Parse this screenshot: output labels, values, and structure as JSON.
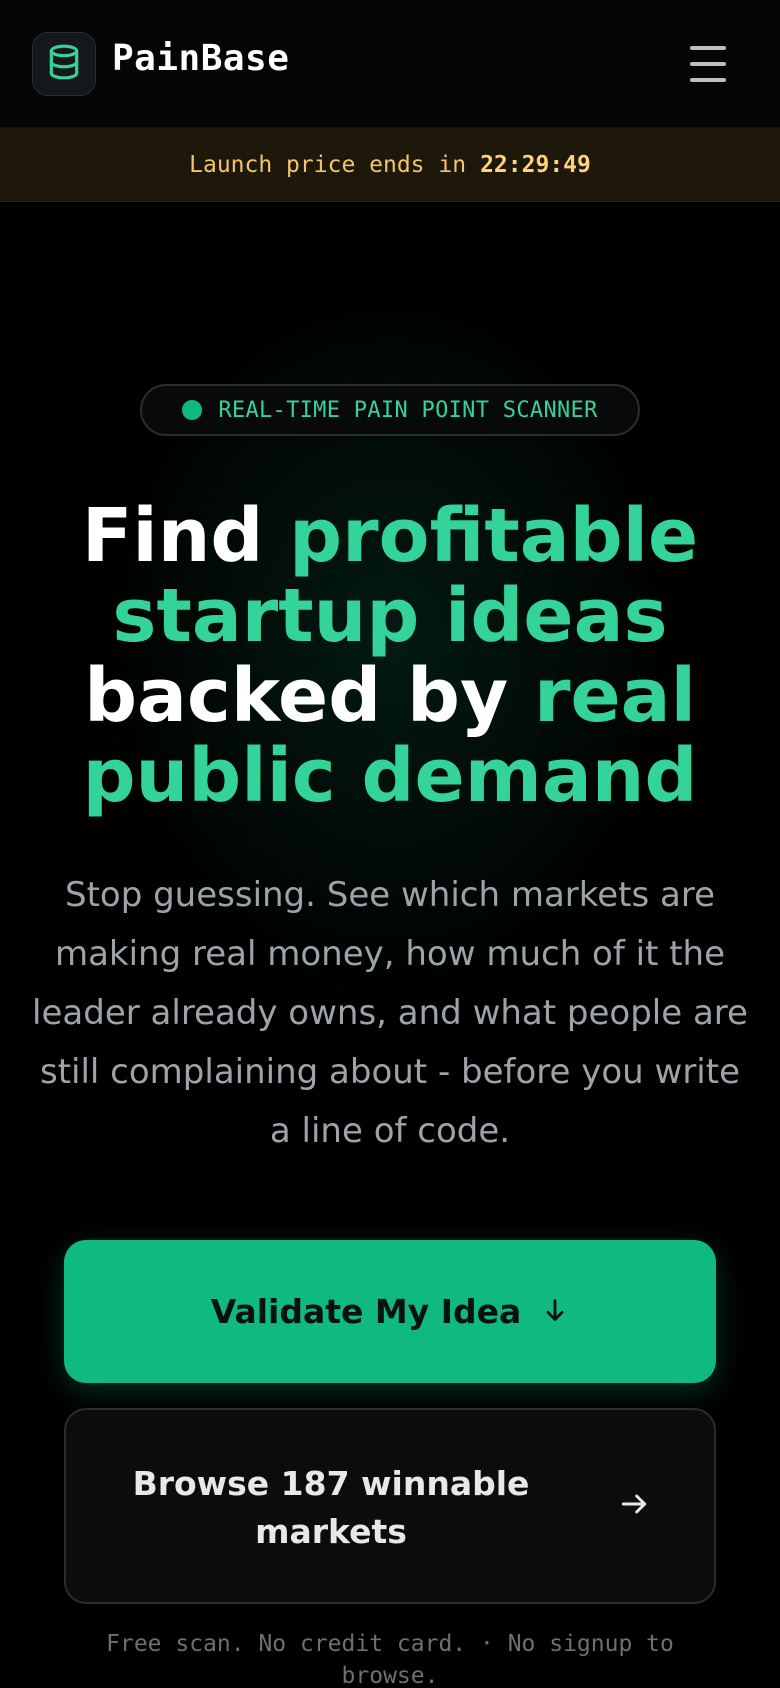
{
  "header": {
    "brand": "PainBase",
    "logo_icon": "database-icon",
    "menu_icon": "hamburger-menu-icon"
  },
  "banner": {
    "text": "Launch price ends in",
    "countdown": "22:29:49"
  },
  "hero": {
    "pill_label": "REAL-TIME PAIN POINT SCANNER",
    "headline": {
      "part1": "Find ",
      "part2": "profitable startup ideas",
      "part3": " backed by ",
      "part4": "real public demand"
    },
    "subtext": "Stop guessing. See which markets are making real money, how much of it the leader already owns, and what people are still complaining about - before you write a line of code."
  },
  "cta": {
    "primary_label": "Validate My Idea",
    "primary_icon": "arrow-down-icon",
    "secondary_label": "Browse 187 winnable markets",
    "secondary_icon": "arrow-right-icon",
    "fineprint": "Free scan. No credit card. · No signup to browse."
  },
  "colors": {
    "accent": "#10b981",
    "accent_text": "#34d399",
    "banner_text": "#f4c46a",
    "background": "#000000"
  }
}
